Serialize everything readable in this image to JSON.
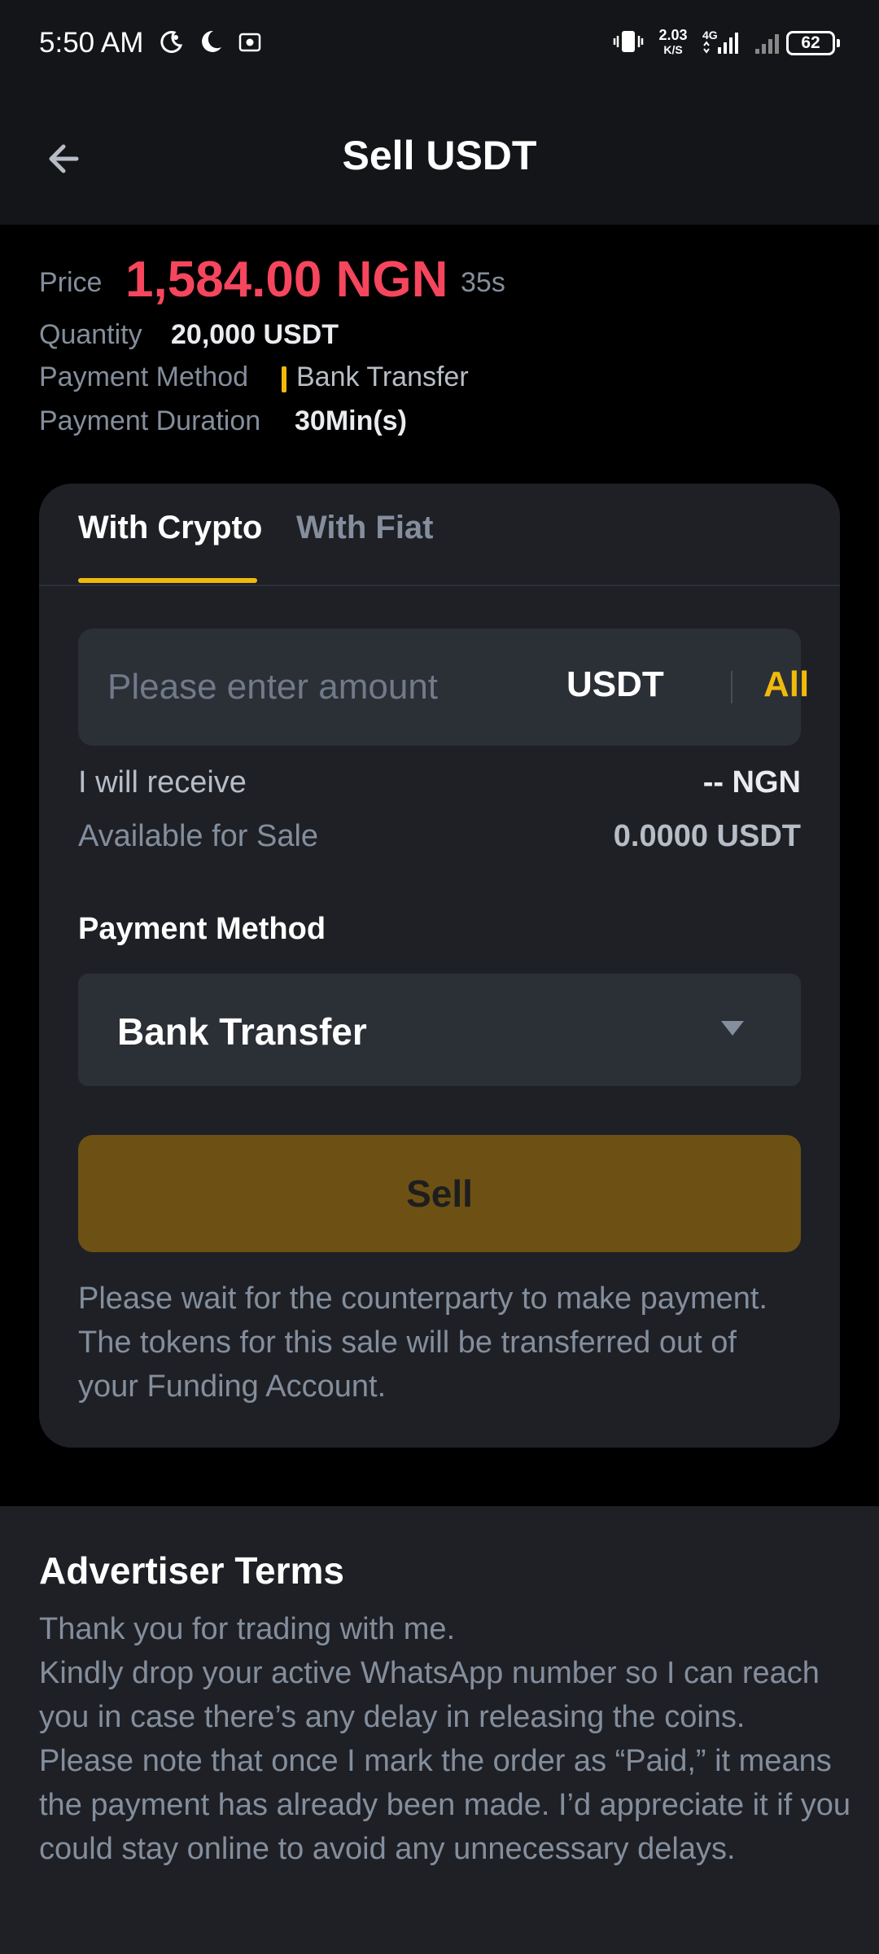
{
  "status_bar": {
    "time": "5:50 AM",
    "speed_value": "2.03",
    "speed_unit": "K/S",
    "network": "4G",
    "battery": "62"
  },
  "header": {
    "title": "Sell USDT",
    "back_icon": "arrow-left-icon"
  },
  "order": {
    "price_label": "Price",
    "price_value": "1,584.00 NGN",
    "countdown": "35s",
    "quantity_label": "Quantity",
    "quantity_value": "20,000 USDT",
    "payment_method_label": "Payment Method",
    "payment_method_value": "Bank Transfer",
    "payment_duration_label": "Payment Duration",
    "payment_duration_value": "30Min(s)"
  },
  "trade_card": {
    "tabs": [
      {
        "label": "With Crypto",
        "active": true
      },
      {
        "label": "With Fiat",
        "active": false
      }
    ],
    "amount_placeholder": "Please enter amount",
    "amount_unit": "USDT",
    "all_label": "All",
    "receive_label": "I will receive",
    "receive_value": "-- NGN",
    "available_label": "Available for Sale",
    "available_value": "0.0000 USDT",
    "payment_method_title": "Payment Method",
    "payment_method_selected": "Bank Transfer",
    "sell_label": "Sell",
    "notice": "Please wait for the counterparty to make payment. The tokens for this sale will be transferred out of your Funding Account."
  },
  "advertiser_terms": {
    "title": "Advertiser Terms",
    "paragraphs": [
      "Thank you for trading with me.",
      "Kindly drop your active WhatsApp number so I can reach you in case there’s any delay in releasing the coins.",
      "Please note that once I mark the order as “Paid,” it means the payment has already been made. I’d appreciate it if you could stay online to avoid any unnecessary delays."
    ]
  },
  "colors": {
    "accent": "#f0b90b",
    "sell_price": "#f6465d",
    "sell_button": "#6d5013",
    "card_bg": "#1e2026",
    "input_bg": "#2b2f36"
  }
}
